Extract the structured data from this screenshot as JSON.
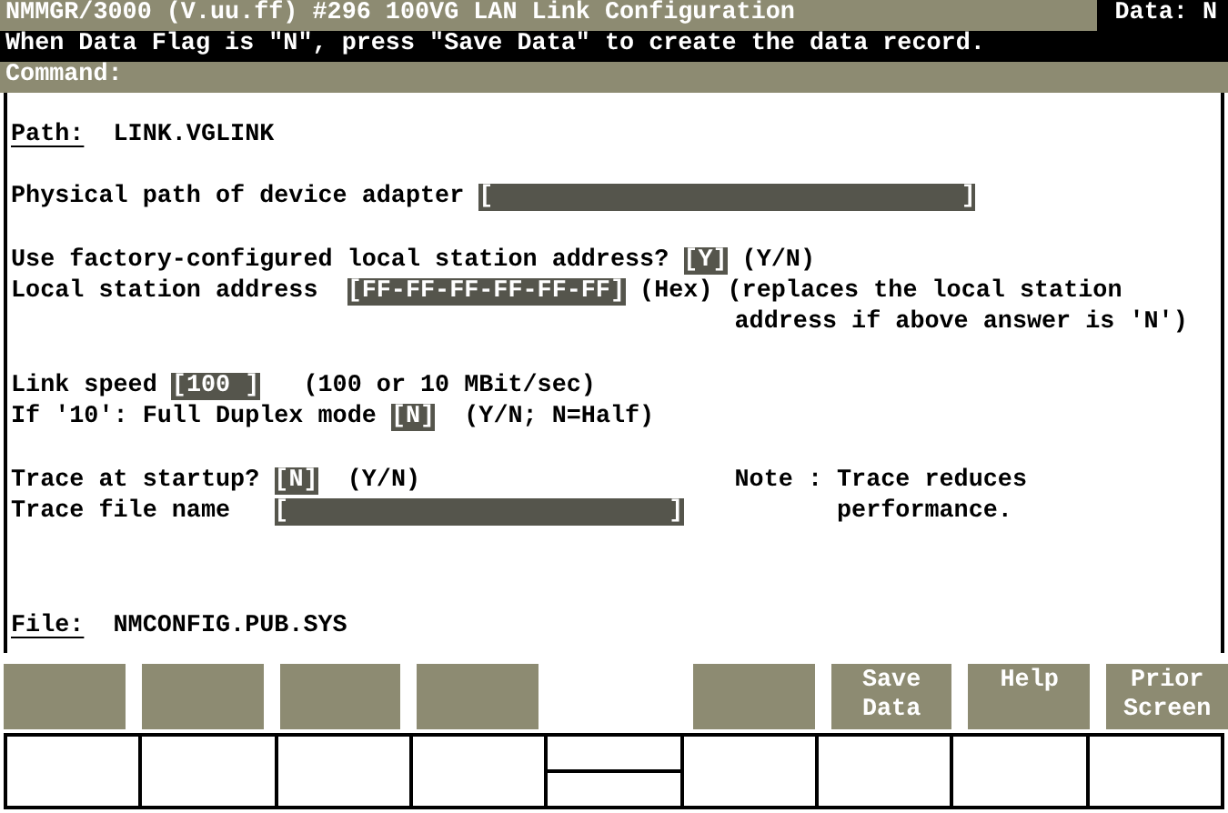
{
  "header": {
    "title": "NMMGR/3000 (V.uu.ff) #296 100VG LAN Link Configuration",
    "data_flag": "Data: N",
    "message": "When Data Flag is \"N\", press \"Save Data\" to create the data record.",
    "command_label": "Command:"
  },
  "path": {
    "label": "Path:",
    "value": "LINK.VGLINK"
  },
  "sections": [
    {
      "lines": [
        {
          "left": [
            {
              "kind": "text",
              "text": "Physical path of device adapter "
            },
            {
              "kind": "field",
              "value": "[                                ]"
            }
          ]
        }
      ]
    },
    {
      "lines": [
        {
          "left": [
            {
              "kind": "text",
              "text": "Use factory-configured local station address? "
            },
            {
              "kind": "field",
              "value": "[Y]"
            },
            {
              "kind": "text",
              "text": " (Y/N)"
            }
          ]
        },
        {
          "left": [
            {
              "kind": "text",
              "text": "Local station address  "
            },
            {
              "kind": "field",
              "value": "[FF-FF-FF-FF-FF-FF]"
            },
            {
              "kind": "text",
              "text": " (Hex) (replaces the local station"
            }
          ]
        },
        {
          "right": [
            {
              "kind": "text",
              "text": "address if above answer is 'N')"
            }
          ]
        }
      ]
    },
    {
      "lines": [
        {
          "left": [
            {
              "kind": "text",
              "text": "Link speed "
            },
            {
              "kind": "field",
              "value": "[100 ]"
            },
            {
              "kind": "text",
              "text": "   (100 or 10 MBit/sec)"
            }
          ]
        },
        {
          "left": [
            {
              "kind": "text",
              "text": "If '10': Full Duplex mode "
            },
            {
              "kind": "field",
              "value": "[N]"
            },
            {
              "kind": "text",
              "text": "  (Y/N; N=Half)"
            }
          ]
        }
      ]
    },
    {
      "lines": [
        {
          "left": [
            {
              "kind": "text",
              "text": "Trace at startup? "
            },
            {
              "kind": "field",
              "value": "[N]"
            },
            {
              "kind": "text",
              "text": "  (Y/N)"
            }
          ],
          "right": [
            {
              "kind": "text",
              "text": "Note : Trace reduces"
            }
          ]
        },
        {
          "left": [
            {
              "kind": "text",
              "text": "Trace file name   "
            },
            {
              "kind": "field",
              "value": "[                          ]"
            }
          ],
          "right": [
            {
              "kind": "text",
              "text": "       performance."
            }
          ]
        }
      ]
    }
  ],
  "file": {
    "label": "File:",
    "value": "NMCONFIG.PUB.SYS"
  },
  "softkeys": [
    {
      "kind": "blank"
    },
    {
      "kind": "blank"
    },
    {
      "kind": "blank"
    },
    {
      "kind": "blank"
    },
    {
      "kind": "absent"
    },
    {
      "kind": "blank"
    },
    {
      "kind": "key",
      "lines": [
        "Save",
        "Data"
      ]
    },
    {
      "kind": "key",
      "lines": [
        "Help"
      ]
    },
    {
      "kind": "key",
      "lines": [
        "Prior",
        "Screen"
      ]
    }
  ]
}
